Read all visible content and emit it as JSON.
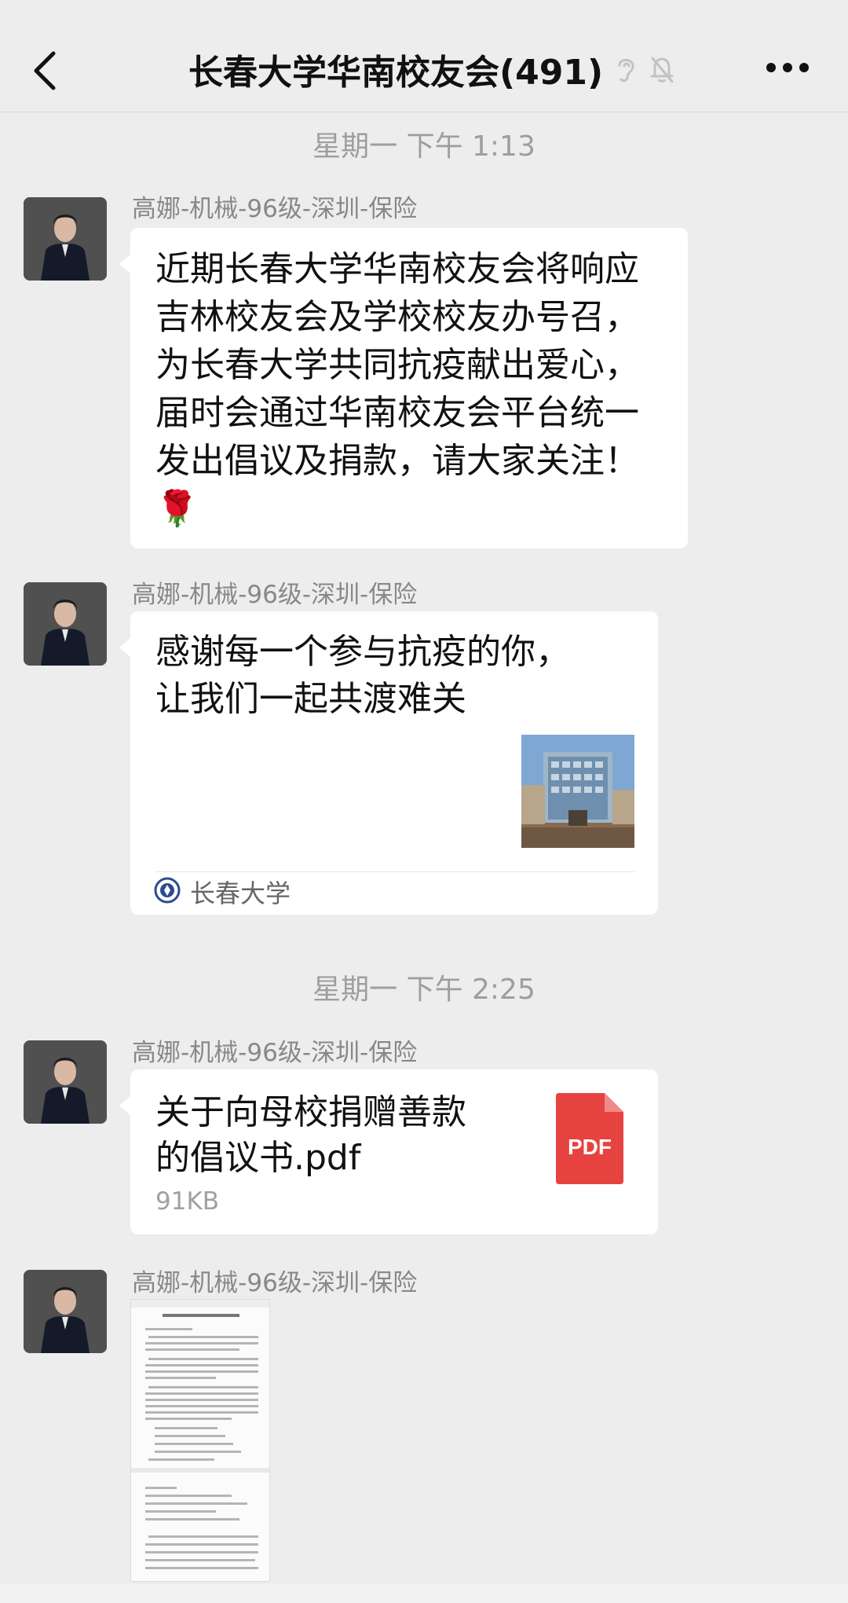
{
  "header": {
    "back_icon": "chevron-left-icon",
    "title": "长春大学华南校友会(491)",
    "icons": [
      "ear-icon",
      "mute-bell-icon"
    ],
    "more_icon": "more-dots-icon"
  },
  "messages": {
    "time1": "星期一 下午 1:13",
    "time2": "星期一 下午 2:25",
    "sender": "高娜-机械-96级-深圳-保险",
    "text1": "近期长春大学华南校友会将响应\n吉林校友会及学校校友办号召，\n为长春大学共同抗疫献出爱心，\n届时会通过华南校友会平台统一\n发出倡议及捐款，请大家关注！\n🌹",
    "link": {
      "title": "感谢每一个参与抗疫的你，\n让我们一起共渡难关",
      "source": "长春大学"
    },
    "file": {
      "name": "关于向母校捐赠善款\n的倡议书.pdf",
      "size": "91KB",
      "icon_label": "PDF",
      "icon_color": "#e64340"
    }
  },
  "colors": {
    "background": "#ededed",
    "bubble": "#ffffff",
    "muted_text": "#9e9e9e"
  }
}
